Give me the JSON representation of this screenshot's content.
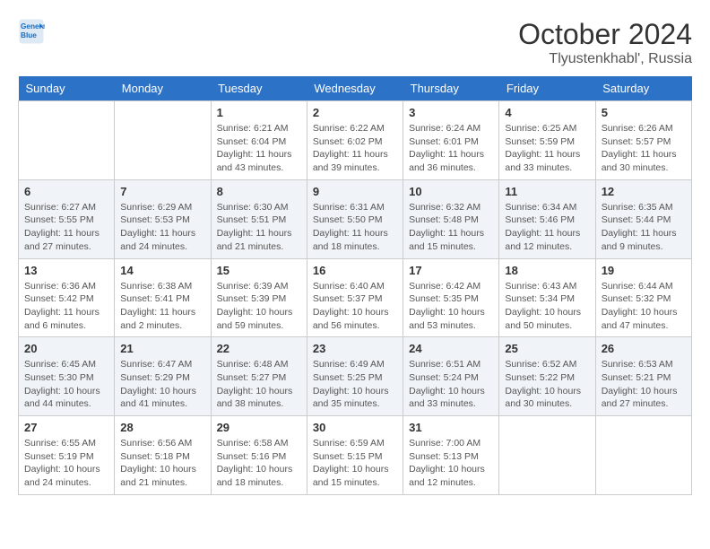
{
  "header": {
    "logo_line1": "General",
    "logo_line2": "Blue",
    "month": "October 2024",
    "location": "Tlyustenkhabl', Russia"
  },
  "days_of_week": [
    "Sunday",
    "Monday",
    "Tuesday",
    "Wednesday",
    "Thursday",
    "Friday",
    "Saturday"
  ],
  "weeks": [
    [
      {
        "day": "",
        "sunrise": "",
        "sunset": "",
        "daylight": ""
      },
      {
        "day": "",
        "sunrise": "",
        "sunset": "",
        "daylight": ""
      },
      {
        "day": "1",
        "sunrise": "Sunrise: 6:21 AM",
        "sunset": "Sunset: 6:04 PM",
        "daylight": "Daylight: 11 hours and 43 minutes."
      },
      {
        "day": "2",
        "sunrise": "Sunrise: 6:22 AM",
        "sunset": "Sunset: 6:02 PM",
        "daylight": "Daylight: 11 hours and 39 minutes."
      },
      {
        "day": "3",
        "sunrise": "Sunrise: 6:24 AM",
        "sunset": "Sunset: 6:01 PM",
        "daylight": "Daylight: 11 hours and 36 minutes."
      },
      {
        "day": "4",
        "sunrise": "Sunrise: 6:25 AM",
        "sunset": "Sunset: 5:59 PM",
        "daylight": "Daylight: 11 hours and 33 minutes."
      },
      {
        "day": "5",
        "sunrise": "Sunrise: 6:26 AM",
        "sunset": "Sunset: 5:57 PM",
        "daylight": "Daylight: 11 hours and 30 minutes."
      }
    ],
    [
      {
        "day": "6",
        "sunrise": "Sunrise: 6:27 AM",
        "sunset": "Sunset: 5:55 PM",
        "daylight": "Daylight: 11 hours and 27 minutes."
      },
      {
        "day": "7",
        "sunrise": "Sunrise: 6:29 AM",
        "sunset": "Sunset: 5:53 PM",
        "daylight": "Daylight: 11 hours and 24 minutes."
      },
      {
        "day": "8",
        "sunrise": "Sunrise: 6:30 AM",
        "sunset": "Sunset: 5:51 PM",
        "daylight": "Daylight: 11 hours and 21 minutes."
      },
      {
        "day": "9",
        "sunrise": "Sunrise: 6:31 AM",
        "sunset": "Sunset: 5:50 PM",
        "daylight": "Daylight: 11 hours and 18 minutes."
      },
      {
        "day": "10",
        "sunrise": "Sunrise: 6:32 AM",
        "sunset": "Sunset: 5:48 PM",
        "daylight": "Daylight: 11 hours and 15 minutes."
      },
      {
        "day": "11",
        "sunrise": "Sunrise: 6:34 AM",
        "sunset": "Sunset: 5:46 PM",
        "daylight": "Daylight: 11 hours and 12 minutes."
      },
      {
        "day": "12",
        "sunrise": "Sunrise: 6:35 AM",
        "sunset": "Sunset: 5:44 PM",
        "daylight": "Daylight: 11 hours and 9 minutes."
      }
    ],
    [
      {
        "day": "13",
        "sunrise": "Sunrise: 6:36 AM",
        "sunset": "Sunset: 5:42 PM",
        "daylight": "Daylight: 11 hours and 6 minutes."
      },
      {
        "day": "14",
        "sunrise": "Sunrise: 6:38 AM",
        "sunset": "Sunset: 5:41 PM",
        "daylight": "Daylight: 11 hours and 2 minutes."
      },
      {
        "day": "15",
        "sunrise": "Sunrise: 6:39 AM",
        "sunset": "Sunset: 5:39 PM",
        "daylight": "Daylight: 10 hours and 59 minutes."
      },
      {
        "day": "16",
        "sunrise": "Sunrise: 6:40 AM",
        "sunset": "Sunset: 5:37 PM",
        "daylight": "Daylight: 10 hours and 56 minutes."
      },
      {
        "day": "17",
        "sunrise": "Sunrise: 6:42 AM",
        "sunset": "Sunset: 5:35 PM",
        "daylight": "Daylight: 10 hours and 53 minutes."
      },
      {
        "day": "18",
        "sunrise": "Sunrise: 6:43 AM",
        "sunset": "Sunset: 5:34 PM",
        "daylight": "Daylight: 10 hours and 50 minutes."
      },
      {
        "day": "19",
        "sunrise": "Sunrise: 6:44 AM",
        "sunset": "Sunset: 5:32 PM",
        "daylight": "Daylight: 10 hours and 47 minutes."
      }
    ],
    [
      {
        "day": "20",
        "sunrise": "Sunrise: 6:45 AM",
        "sunset": "Sunset: 5:30 PM",
        "daylight": "Daylight: 10 hours and 44 minutes."
      },
      {
        "day": "21",
        "sunrise": "Sunrise: 6:47 AM",
        "sunset": "Sunset: 5:29 PM",
        "daylight": "Daylight: 10 hours and 41 minutes."
      },
      {
        "day": "22",
        "sunrise": "Sunrise: 6:48 AM",
        "sunset": "Sunset: 5:27 PM",
        "daylight": "Daylight: 10 hours and 38 minutes."
      },
      {
        "day": "23",
        "sunrise": "Sunrise: 6:49 AM",
        "sunset": "Sunset: 5:25 PM",
        "daylight": "Daylight: 10 hours and 35 minutes."
      },
      {
        "day": "24",
        "sunrise": "Sunrise: 6:51 AM",
        "sunset": "Sunset: 5:24 PM",
        "daylight": "Daylight: 10 hours and 33 minutes."
      },
      {
        "day": "25",
        "sunrise": "Sunrise: 6:52 AM",
        "sunset": "Sunset: 5:22 PM",
        "daylight": "Daylight: 10 hours and 30 minutes."
      },
      {
        "day": "26",
        "sunrise": "Sunrise: 6:53 AM",
        "sunset": "Sunset: 5:21 PM",
        "daylight": "Daylight: 10 hours and 27 minutes."
      }
    ],
    [
      {
        "day": "27",
        "sunrise": "Sunrise: 6:55 AM",
        "sunset": "Sunset: 5:19 PM",
        "daylight": "Daylight: 10 hours and 24 minutes."
      },
      {
        "day": "28",
        "sunrise": "Sunrise: 6:56 AM",
        "sunset": "Sunset: 5:18 PM",
        "daylight": "Daylight: 10 hours and 21 minutes."
      },
      {
        "day": "29",
        "sunrise": "Sunrise: 6:58 AM",
        "sunset": "Sunset: 5:16 PM",
        "daylight": "Daylight: 10 hours and 18 minutes."
      },
      {
        "day": "30",
        "sunrise": "Sunrise: 6:59 AM",
        "sunset": "Sunset: 5:15 PM",
        "daylight": "Daylight: 10 hours and 15 minutes."
      },
      {
        "day": "31",
        "sunrise": "Sunrise: 7:00 AM",
        "sunset": "Sunset: 5:13 PM",
        "daylight": "Daylight: 10 hours and 12 minutes."
      },
      {
        "day": "",
        "sunrise": "",
        "sunset": "",
        "daylight": ""
      },
      {
        "day": "",
        "sunrise": "",
        "sunset": "",
        "daylight": ""
      }
    ]
  ]
}
